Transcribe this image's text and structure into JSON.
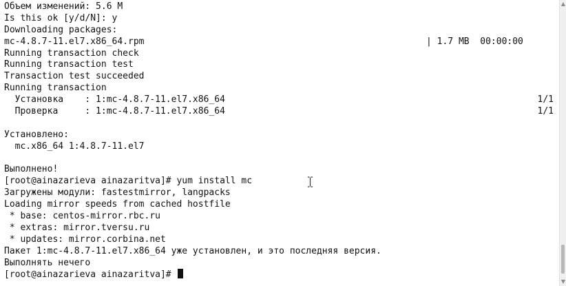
{
  "terminal": {
    "lines": [
      {
        "text": "Объем изменений: 5.6 M"
      },
      {
        "text": "Is this ok [y/d/N]: y"
      },
      {
        "text": "Downloading packages:"
      },
      {
        "text": "mc-4.8.7-11.el7.x86_64.rpm",
        "mid": "| 1.7 MB  00:00:00"
      },
      {
        "text": "Running transaction check"
      },
      {
        "text": "Running transaction test"
      },
      {
        "text": "Transaction test succeeded"
      },
      {
        "text": "Running transaction"
      },
      {
        "text": "  Установка    : 1:mc-4.8.7-11.el7.x86_64",
        "right": "1/1"
      },
      {
        "text": "  Проверка     : 1:mc-4.8.7-11.el7.x86_64",
        "right": "1/1"
      },
      {
        "text": ""
      },
      {
        "text": "Установлено:"
      },
      {
        "text": "  mc.x86_64 1:4.8.7-11.el7"
      },
      {
        "text": ""
      },
      {
        "text": "Выполнено!"
      },
      {
        "text": "[root@ainazarieva ainazaritva]# yum install mc"
      },
      {
        "text": "Загружены модули: fastestmirror, langpacks"
      },
      {
        "text": "Loading mirror speeds from cached hostfile"
      },
      {
        "text": " * base: centos-mirror.rbc.ru"
      },
      {
        "text": " * extras: mirror.tversu.ru"
      },
      {
        "text": " * updates: mirror.corbina.net"
      },
      {
        "text": "Пакет 1:mc-4.8.7-11.el7.x86_64 уже установлен, и это последняя версия."
      },
      {
        "text": "Выполнять нечего"
      },
      {
        "text": "[root@ainazarieva ainazaritva]# ",
        "cursor": true
      }
    ]
  },
  "icons": {
    "text_cursor": "i-beam-cursor-icon",
    "scroll_up": "scroll-up-arrow-icon",
    "scroll_down": "scroll-down-arrow-icon"
  },
  "colors": {
    "background": "#ffffff",
    "foreground": "#111111"
  }
}
